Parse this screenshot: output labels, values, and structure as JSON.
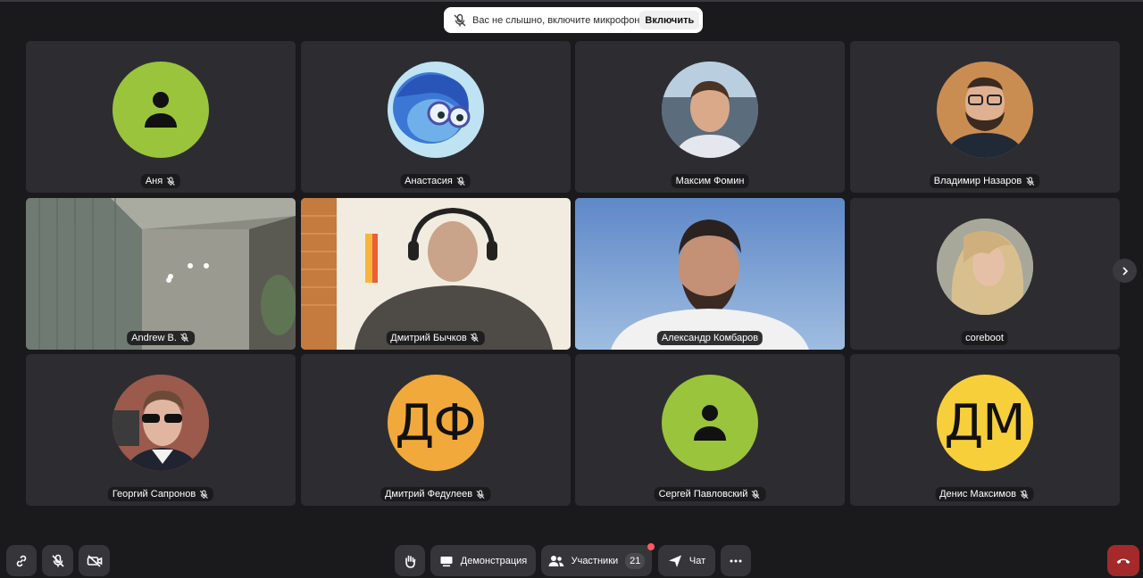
{
  "notification": {
    "text": "Вас не слышно, включите микрофон",
    "button": "Включить",
    "icon": "mic-off-icon"
  },
  "participants": [
    {
      "name": "Аня",
      "muted": true,
      "avatar": "placeholder"
    },
    {
      "name": "Анастасия",
      "muted": true,
      "avatar": "photo"
    },
    {
      "name": "Максим Фомин",
      "muted": false,
      "avatar": "photo"
    },
    {
      "name": "Владимир Назаров",
      "muted": true,
      "avatar": "photo"
    },
    {
      "name": "Andrew B.",
      "muted": true,
      "avatar": "video"
    },
    {
      "name": "Дмитрий Бычков",
      "muted": true,
      "avatar": "video"
    },
    {
      "name": "Александр Комбаров",
      "muted": false,
      "avatar": "video",
      "speaking": true
    },
    {
      "name": "coreboot",
      "muted": false,
      "avatar": "photo"
    },
    {
      "name": "Георгий Сапронов",
      "muted": true,
      "avatar": "photo"
    },
    {
      "name": "Дмитрий Федулеев",
      "muted": true,
      "avatar": "initials",
      "initials": "ДФ"
    },
    {
      "name": "Сергей Павловский",
      "muted": true,
      "avatar": "placeholder"
    },
    {
      "name": "Денис Максимов",
      "muted": true,
      "avatar": "initials",
      "initials": "ДМ"
    }
  ],
  "toolbar": {
    "demo_label": "Демонстрация",
    "participants_label": "Участники",
    "participants_count": "21",
    "chat_label": "Чат"
  },
  "colors": {
    "background": "#1a1a1c",
    "tile": "#2d2d31",
    "speaking_border": "#4be07a",
    "avatar_green": "#9ac43c",
    "avatar_orange": "#f2a93b",
    "avatar_yellow": "#f7cf3b",
    "hangup": "#a3292b"
  }
}
